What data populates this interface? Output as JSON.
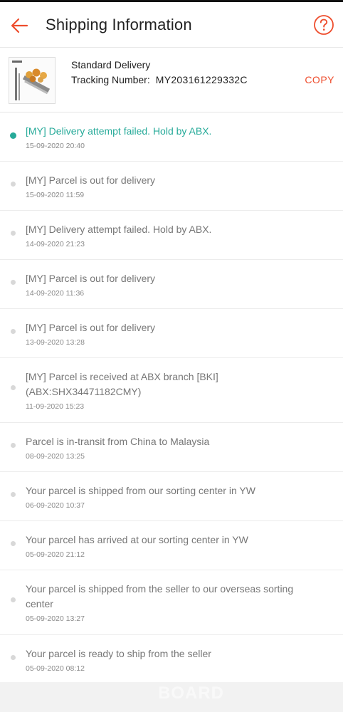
{
  "header": {
    "title": "Shipping Information",
    "back_icon": "arrow-left-icon",
    "help_icon": "question-circle-icon",
    "accent_color": "#ee4d2d"
  },
  "delivery": {
    "service": "Standard Delivery",
    "tracking_label": "Tracking Number:",
    "tracking_number": "MY203161229332C",
    "copy_label": "COPY"
  },
  "timeline": {
    "active_color": "#26aa99",
    "events": [
      {
        "message": "[MY] Delivery attempt failed. Hold by ABX.",
        "time": "15-09-2020 20:40",
        "active": true
      },
      {
        "message": "[MY] Parcel is out for delivery",
        "time": "15-09-2020 11:59"
      },
      {
        "message": "[MY] Delivery attempt failed. Hold by ABX.",
        "time": "14-09-2020 21:23"
      },
      {
        "message": "[MY] Parcel is out for delivery",
        "time": "14-09-2020 11:36"
      },
      {
        "message": "[MY] Parcel is out for delivery",
        "time": "13-09-2020 13:28"
      },
      {
        "message": "[MY] Parcel is received at ABX branch [BKI] (ABX:SHX34471182CMY)",
        "time": "11-09-2020 15:23"
      },
      {
        "message": "Parcel is in-transit from China to Malaysia",
        "time": "08-09-2020 13:25"
      },
      {
        "message": "Your parcel is shipped from our sorting center in YW",
        "time": "06-09-2020 10:37"
      },
      {
        "message": "Your parcel has arrived at our sorting center in YW",
        "time": "05-09-2020 21:12"
      },
      {
        "message": "Your parcel is shipped from the seller to our overseas sorting center",
        "time": "05-09-2020 13:27"
      },
      {
        "message": "Your parcel is ready to ship from the seller",
        "time": "05-09-2020 08:12"
      }
    ]
  },
  "watermark": "BOARD"
}
